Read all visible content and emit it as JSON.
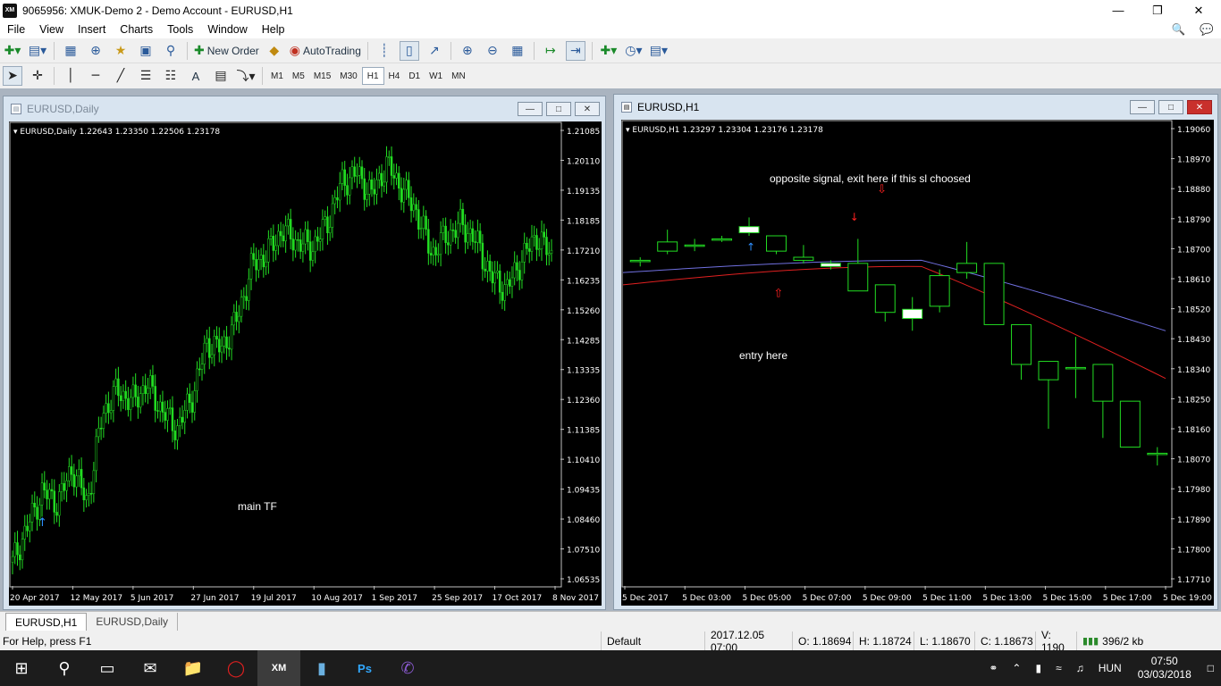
{
  "window": {
    "title": "9065956: XMUK-Demo 2 - Demo Account - EURUSD,H1",
    "icon": "XM"
  },
  "menu": [
    "File",
    "View",
    "Insert",
    "Charts",
    "Tools",
    "Window",
    "Help"
  ],
  "toolbar": {
    "new_order": "New Order",
    "autotrading": "AutoTrading"
  },
  "timeframes": [
    "M1",
    "M5",
    "M15",
    "M30",
    "H1",
    "H4",
    "D1",
    "W1",
    "MN"
  ],
  "active_timeframe": "H1",
  "left_chart": {
    "window_title": "EURUSD,Daily",
    "info": "EURUSD,Daily  1.22643 1.23350 1.22506 1.23178",
    "annotation": "main TF",
    "y_ticks": [
      "1.21085",
      "1.20110",
      "1.19135",
      "1.18185",
      "1.17210",
      "1.16235",
      "1.15260",
      "1.14285",
      "1.13335",
      "1.12360",
      "1.11385",
      "1.10410",
      "1.09435",
      "1.08460",
      "1.07510",
      "1.06535"
    ],
    "x_ticks": [
      "20 Apr 2017",
      "12 May 2017",
      "5 Jun 2017",
      "27 Jun 2017",
      "19 Jul 2017",
      "10 Aug 2017",
      "1 Sep 2017",
      "25 Sep 2017",
      "17 Oct 2017",
      "8 Nov 2017"
    ]
  },
  "right_chart": {
    "window_title": "EURUSD,H1",
    "info": "EURUSD,H1  1.23297 1.23304 1.23176 1.23178",
    "annotation_top": "opposite signal, exit here if this sl choosed",
    "annotation_entry": "entry here",
    "y_ticks": [
      "1.19060",
      "1.18970",
      "1.18880",
      "1.18790",
      "1.18700",
      "1.18610",
      "1.18520",
      "1.18430",
      "1.18340",
      "1.18250",
      "1.18160",
      "1.18070",
      "1.17980",
      "1.17890",
      "1.17800",
      "1.17710"
    ],
    "x_ticks": [
      "5 Dec 2017",
      "5 Dec 03:00",
      "5 Dec 05:00",
      "5 Dec 07:00",
      "5 Dec 09:00",
      "5 Dec 11:00",
      "5 Dec 13:00",
      "5 Dec 15:00",
      "5 Dec 17:00",
      "5 Dec 19:00"
    ]
  },
  "chart_data": [
    {
      "type": "candlestick",
      "title": "EURUSD,Daily",
      "ylim": [
        1.0625,
        1.2135
      ],
      "close_path": [
        1.068,
        1.08,
        1.092,
        1.088,
        1.1,
        1.088,
        1.118,
        1.126,
        1.122,
        1.128,
        1.119,
        1.113,
        1.124,
        1.142,
        1.14,
        1.15,
        1.168,
        1.172,
        1.18,
        1.176,
        1.174,
        1.182,
        1.196,
        1.199,
        1.192,
        1.202,
        1.194,
        1.186,
        1.172,
        1.178,
        1.182,
        1.176,
        1.164,
        1.16,
        1.17,
        1.178,
        1.171
      ]
    },
    {
      "type": "candlestick",
      "title": "EURUSD,H1",
      "ylim": [
        1.1765,
        1.1912
      ],
      "candles": [
        [
          1.1869,
          1.187,
          1.1867,
          1.1869
        ],
        [
          1.1872,
          1.1879,
          1.1871,
          1.1875
        ],
        [
          1.1874,
          1.1876,
          1.1872,
          1.1874
        ],
        [
          1.1876,
          1.1877,
          1.1875,
          1.1876
        ],
        [
          1.188,
          1.1883,
          1.1877,
          1.1878
        ],
        [
          1.1872,
          1.1877,
          1.1871,
          1.1877
        ],
        [
          1.1869,
          1.1874,
          1.1868,
          1.187
        ],
        [
          1.1868,
          1.1869,
          1.1866,
          1.1867
        ],
        [
          1.1859,
          1.1876,
          1.1859,
          1.1868
        ],
        [
          1.1852,
          1.1861,
          1.1849,
          1.1861
        ],
        [
          1.1853,
          1.1857,
          1.1846,
          1.185
        ],
        [
          1.1854,
          1.1866,
          1.1852,
          1.1864
        ],
        [
          1.1865,
          1.1875,
          1.1863,
          1.1868
        ],
        [
          1.1848,
          1.1868,
          1.1848,
          1.1868
        ],
        [
          1.1835,
          1.1848,
          1.183,
          1.1848
        ],
        [
          1.183,
          1.1836,
          1.1814,
          1.1836
        ],
        [
          1.1834,
          1.1844,
          1.1824,
          1.1834
        ],
        [
          1.1823,
          1.1835,
          1.1811,
          1.1835
        ],
        [
          1.1808,
          1.1823,
          1.1808,
          1.1823
        ],
        [
          1.1806,
          1.1808,
          1.1802,
          1.1806
        ]
      ]
    }
  ]
}
